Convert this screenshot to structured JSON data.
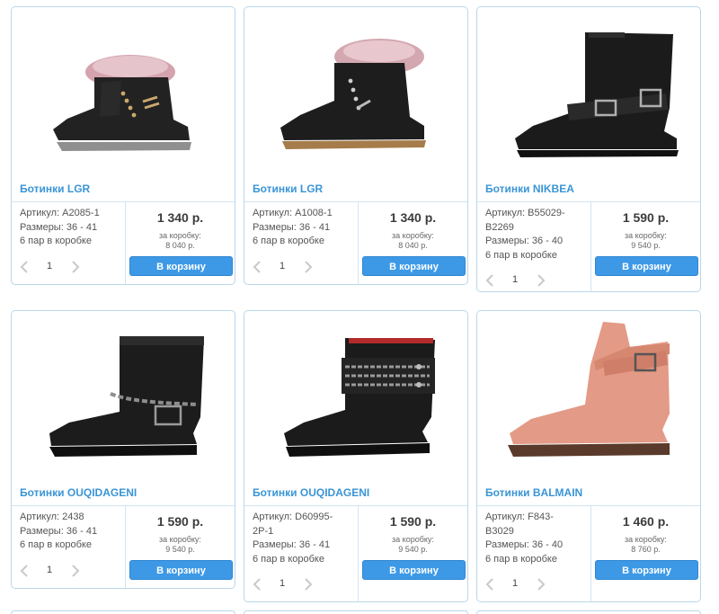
{
  "products": [
    {
      "title": "Ботинки LGR",
      "info": [
        "Артикул: A2085-1",
        "Размеры: 36 - 41",
        "6 пар в коробке"
      ],
      "price": "1 340 р.",
      "box_label": "за коробку:",
      "box_price": "8 040 р.",
      "qty": "1",
      "cart_label": "В корзину",
      "image_icon": "fur-lace-up-boot"
    },
    {
      "title": "Ботинки LGR",
      "info": [
        "Артикул: A1008-1",
        "Размеры: 36 - 41",
        "6 пар в коробке"
      ],
      "price": "1 340 р.",
      "box_label": "за коробку:",
      "box_price": "8 040 р.",
      "qty": "1",
      "cart_label": "В корзину",
      "image_icon": "fur-lace-up-boot"
    },
    {
      "title": "Ботинки NIKBEA",
      "info": [
        "Артикул: B55029-",
        "B2269",
        "Размеры: 36 - 40",
        "6 пар в коробке"
      ],
      "price": "1 590 р.",
      "box_label": "за коробку:",
      "box_price": "9 540 р.",
      "qty": "1",
      "cart_label": "В корзину",
      "image_icon": "buckle-ankle-boot"
    },
    {
      "title": "Ботинки OUQIDAGENI",
      "info": [
        "Артикул: 2438",
        "Размеры: 36 - 41",
        "6 пар в коробке"
      ],
      "price": "1 590 р.",
      "box_label": "за коробку:",
      "box_price": "9 540 р.",
      "qty": "1",
      "cart_label": "В корзину",
      "image_icon": "chain-ankle-boot"
    },
    {
      "title": "Ботинки OUQIDAGENI",
      "info": [
        "Артикул: D60995-",
        "2P-1",
        "Размеры: 36 - 41",
        "6 пар в коробке"
      ],
      "price": "1 590 р.",
      "box_label": "за коробку:",
      "box_price": "9 540 р.",
      "qty": "1",
      "cart_label": "В корзину",
      "image_icon": "chain-strap-ankle-boot"
    },
    {
      "title": "Ботинки BALMAIN",
      "info": [
        "Артикул: F843-",
        "B3029",
        "Размеры: 36 - 40",
        "6 пар в коробке"
      ],
      "price": "1 460 р.",
      "box_label": "за коробку:",
      "box_price": "8 760 р.",
      "qty": "1",
      "cart_label": "В корзину",
      "image_icon": "pink-buckle-boot"
    }
  ],
  "colors": {
    "accent": "#3d99e6",
    "title": "#3a95d6",
    "border": "#b9d7ea",
    "pink_boot": "#e39a86"
  }
}
